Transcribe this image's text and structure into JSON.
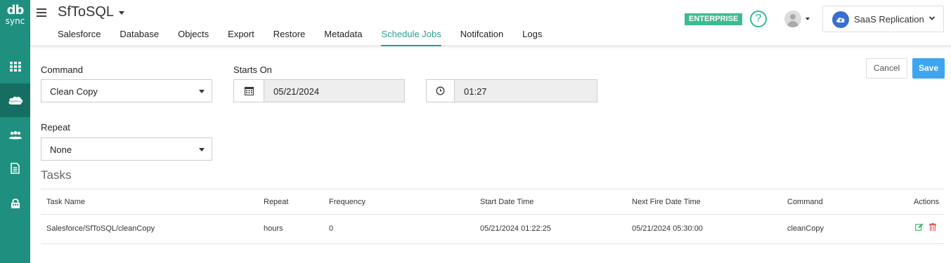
{
  "brand": {
    "logo_top": "db",
    "logo_bottom": "sync"
  },
  "header": {
    "app_title": "SfToSQL",
    "tabs": [
      {
        "label": "Salesforce",
        "active": false
      },
      {
        "label": "Database",
        "active": false
      },
      {
        "label": "Objects",
        "active": false
      },
      {
        "label": "Export",
        "active": false
      },
      {
        "label": "Restore",
        "active": false
      },
      {
        "label": "Metadata",
        "active": false
      },
      {
        "label": "Schedule Jobs",
        "active": true
      },
      {
        "label": "Notifcation",
        "active": false
      },
      {
        "label": "Logs",
        "active": false
      }
    ],
    "edition_badge": "ENTERPRISE",
    "help_symbol": "?",
    "product_switcher": "SaaS Replication"
  },
  "sidebar": {
    "items": [
      {
        "icon": "grid-icon",
        "active": false
      },
      {
        "icon": "salesforce-cloud-icon",
        "active": true
      },
      {
        "icon": "users-icon",
        "active": false
      },
      {
        "icon": "document-icon",
        "active": false
      },
      {
        "icon": "lock-icon",
        "active": false
      }
    ]
  },
  "form": {
    "command_label": "Command",
    "command_value": "Clean Copy",
    "starts_on_label": "Starts On",
    "date_value": "05/21/2024",
    "time_value": "01:27",
    "repeat_label": "Repeat",
    "repeat_value": "None",
    "cancel_label": "Cancel",
    "save_label": "Save"
  },
  "tasks": {
    "title": "Tasks",
    "columns": [
      "Task Name",
      "Repeat",
      "Frequency",
      "Start Date Time",
      "Next Fire Date Time",
      "Command",
      "Actions"
    ],
    "rows": [
      {
        "task_name": "Salesforce/SfToSQL/cleanCopy",
        "repeat": "hours",
        "frequency": "0",
        "start": "05/21/2024 01:22:25",
        "next_fire": "05/21/2024 05:30:00",
        "command": "cleanCopy"
      }
    ]
  },
  "colors": {
    "sidebar": "#1f8f7f",
    "sidebar_active": "#156e62",
    "accent": "#2aa192",
    "badge": "#3dbb8f",
    "save_button": "#3da6f0",
    "edit_icon": "#2fb35f",
    "delete_icon": "#e05252"
  }
}
